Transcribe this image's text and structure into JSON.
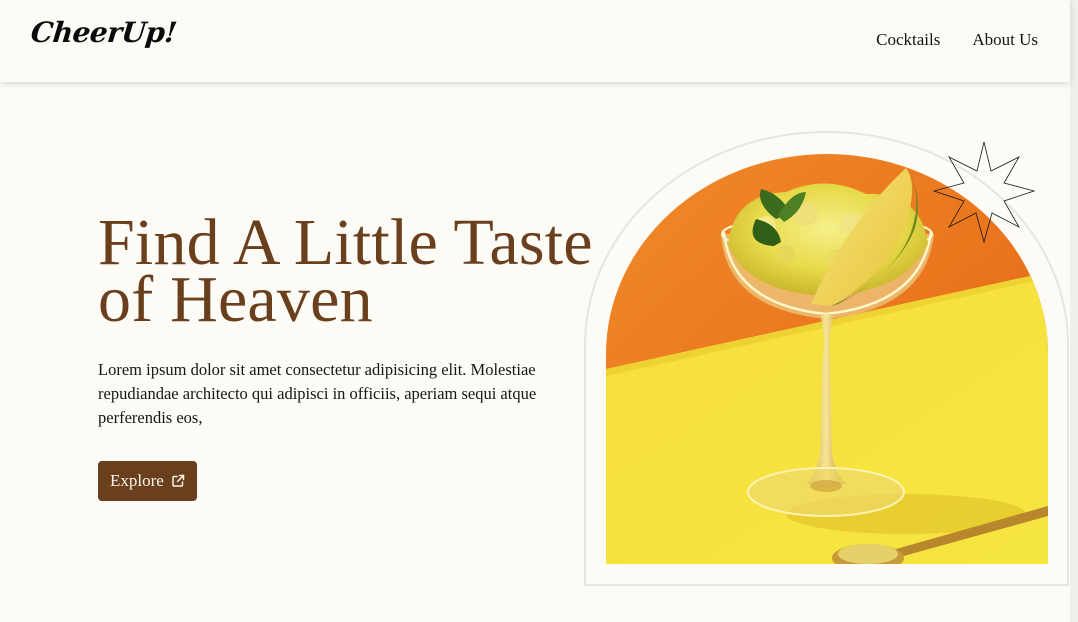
{
  "header": {
    "logo": "CheerUp!",
    "nav": [
      {
        "label": "Cocktails"
      },
      {
        "label": "About Us"
      }
    ]
  },
  "hero": {
    "title_line1": "Find A Little Taste",
    "title_line2": "of Heaven",
    "description": "Lorem ipsum dolor sit amet consectetur adipisicing elit. Molestiae repudiandae architecto qui adipisci in officiis, aperiam sequi atque perferendis eos,",
    "cta_label": "Explore",
    "cta_icon": "external-link-icon",
    "image_subject": "cocktail-glass-with-melon-sorbet"
  },
  "colors": {
    "page_bg": "#fcfbf6",
    "brand_brown": "#6a3f1d",
    "image_orange": "#ec7a20",
    "image_yellow": "#f7e339",
    "arch_border": "#e6e5e3"
  }
}
